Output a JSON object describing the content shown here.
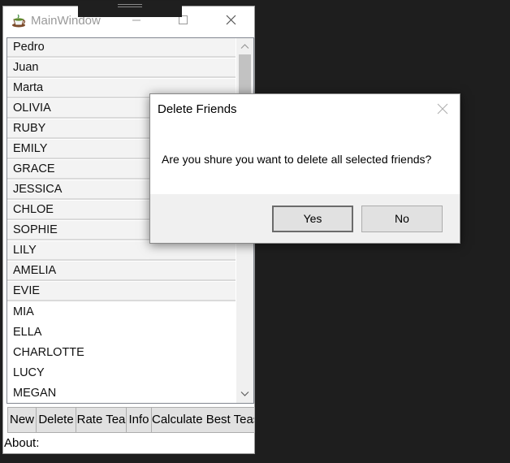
{
  "main_window": {
    "title": "MainWindow",
    "icon": "tea-cup-icon",
    "friends": [
      {
        "name": "Pedro",
        "selected": true
      },
      {
        "name": "Juan",
        "selected": true
      },
      {
        "name": "Marta",
        "selected": true
      },
      {
        "name": "OLIVIA",
        "selected": true
      },
      {
        "name": "RUBY",
        "selected": true
      },
      {
        "name": "EMILY",
        "selected": true
      },
      {
        "name": "GRACE",
        "selected": true
      },
      {
        "name": "JESSICA",
        "selected": true
      },
      {
        "name": "CHLOE",
        "selected": true
      },
      {
        "name": "SOPHIE",
        "selected": true
      },
      {
        "name": "LILY",
        "selected": true
      },
      {
        "name": "AMELIA",
        "selected": true
      },
      {
        "name": "EVIE",
        "selected": true
      },
      {
        "name": "MIA",
        "selected": false
      },
      {
        "name": "ELLA",
        "selected": false
      },
      {
        "name": "CHARLOTTE",
        "selected": false
      },
      {
        "name": "LUCY",
        "selected": false
      },
      {
        "name": "MEGAN",
        "selected": false
      }
    ],
    "buttons": {
      "new": "New",
      "delete": "Delete",
      "rate_tea": "Rate Tea",
      "info": "Info",
      "calculate": "Calculate Best Teas"
    },
    "about_label": "About:"
  },
  "dialog": {
    "title": "Delete Friends",
    "message": "Are you shure you want to delete all selected friends?",
    "yes": "Yes",
    "no": "No"
  },
  "colors": {
    "background": "#1e1e1e",
    "selection": "#f3f3f3",
    "button_face": "#e1e1e1",
    "dialog_footer": "#f0f0f0"
  }
}
